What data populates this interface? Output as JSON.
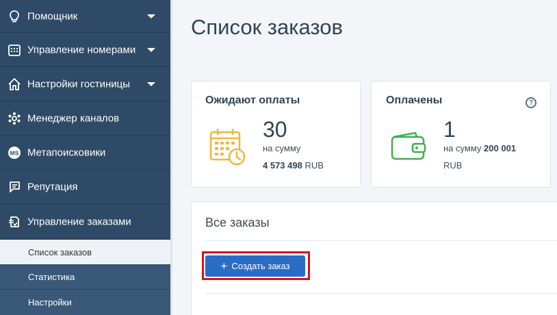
{
  "sidebar": {
    "items": [
      {
        "label": "Помощник",
        "icon": "lightbulb-icon"
      },
      {
        "label": "Управление номерами",
        "icon": "calendar-grid-icon"
      },
      {
        "label": "Настройки гостиницы",
        "icon": "house-icon"
      },
      {
        "label": "Менеджер каналов",
        "icon": "gear-network-icon"
      },
      {
        "label": "Метапоисковики",
        "icon": "ms-badge-icon",
        "badge": "MS"
      },
      {
        "label": "Репутация",
        "icon": "comment-icon"
      },
      {
        "label": "Управление заказами",
        "icon": "orders-icon"
      }
    ],
    "subitems": [
      {
        "label": "Список заказов",
        "active": true
      },
      {
        "label": "Статистика",
        "active": false
      },
      {
        "label": "Настройки",
        "active": false
      }
    ]
  },
  "main": {
    "title": "Список заказов",
    "awaiting": {
      "title": "Ожидают оплаты",
      "count": "30",
      "sum_label": "на сумму",
      "amount": "4 573 498",
      "currency": "RUB",
      "icon": "calendar-clock-icon"
    },
    "paid": {
      "title": "Оплачены",
      "count": "1",
      "sum_label": "на сумму",
      "amount": "200 001",
      "currency": "RUB",
      "icon": "wallet-icon",
      "help": "?"
    },
    "orders": {
      "title": "Все заказы",
      "create_label": "Создать заказ"
    }
  },
  "colors": {
    "sidebar_bg": "#2e4a66",
    "accent": "#2b6cc4",
    "highlight": "#d4121b",
    "awaiting_icon": "#f2b53c",
    "paid_icon": "#3fae49"
  }
}
